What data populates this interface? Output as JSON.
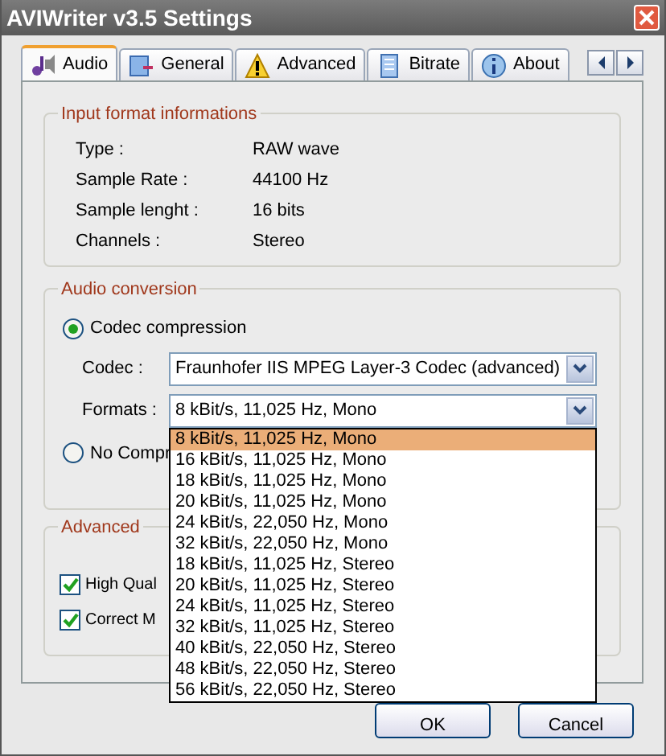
{
  "window": {
    "title": "AVIWriter v3.5 Settings"
  },
  "tabs": [
    {
      "label": "Audio",
      "selected": true
    },
    {
      "label": "General",
      "selected": false
    },
    {
      "label": "Advanced",
      "selected": false
    },
    {
      "label": "Bitrate",
      "selected": false
    },
    {
      "label": "About",
      "selected": false
    }
  ],
  "input_format": {
    "title": "Input format informations",
    "rows": [
      {
        "label": "Type :",
        "value": "RAW wave"
      },
      {
        "label": "Sample Rate :",
        "value": "44100 Hz"
      },
      {
        "label": "Sample lenght :",
        "value": "16 bits"
      },
      {
        "label": "Channels :",
        "value": "Stereo"
      }
    ]
  },
  "audio_conversion": {
    "title": "Audio conversion",
    "options": [
      {
        "label": "Codec compression",
        "selected": true
      },
      {
        "label": "No Compr",
        "selected": false
      }
    ],
    "codec": {
      "label": "Codec :",
      "value": "Fraunhofer IIS MPEG Layer-3 Codec (advanced)"
    },
    "formats": {
      "label": "Formats :",
      "value": "8 kBit/s, 11,025 Hz, Mono",
      "expanded": true,
      "options": [
        {
          "label": "8 kBit/s, 11,025 Hz, Mono",
          "selected": true
        },
        {
          "label": "16 kBit/s, 11,025 Hz, Mono",
          "selected": false
        },
        {
          "label": "18 kBit/s, 11,025 Hz, Mono",
          "selected": false
        },
        {
          "label": "20 kBit/s, 11,025 Hz, Mono",
          "selected": false
        },
        {
          "label": "24 kBit/s, 22,050 Hz, Mono",
          "selected": false
        },
        {
          "label": "32 kBit/s, 22,050 Hz, Mono",
          "selected": false
        },
        {
          "label": "18 kBit/s, 11,025 Hz, Stereo",
          "selected": false
        },
        {
          "label": "20 kBit/s, 11,025 Hz, Stereo",
          "selected": false
        },
        {
          "label": "24 kBit/s, 11,025 Hz, Stereo",
          "selected": false
        },
        {
          "label": "32 kBit/s, 11,025 Hz, Stereo",
          "selected": false
        },
        {
          "label": "40 kBit/s, 22,050 Hz, Stereo",
          "selected": false
        },
        {
          "label": "48 kBit/s, 22,050 Hz, Stereo",
          "selected": false
        },
        {
          "label": "56 kBit/s, 22,050 Hz, Stereo",
          "selected": false
        }
      ]
    }
  },
  "advanced": {
    "title": "Advanced",
    "checkboxes": [
      {
        "label": "High Qual",
        "checked": true
      },
      {
        "label": "Correct M",
        "checked": true
      }
    ]
  },
  "buttons": [
    {
      "label": "OK"
    },
    {
      "label": "Cancel"
    }
  ]
}
